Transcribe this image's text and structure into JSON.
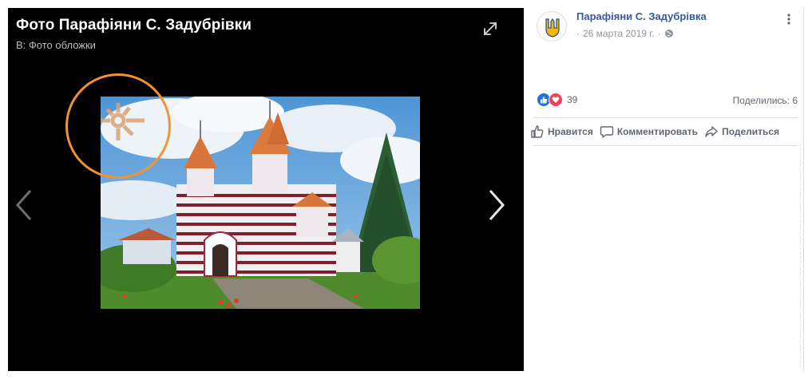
{
  "viewer": {
    "title": "Фото Парафіяни С. Задубрівки",
    "subtitle": "В: Фото обложки",
    "background": "#000000",
    "ring_color": "#f39232"
  },
  "post": {
    "page_name": "Парафіяни С. Задубрівка",
    "date": "26 марта 2019 г.",
    "dot": "·",
    "reaction_count": "39",
    "shares": "Поделились: 6",
    "link_color": "#385898"
  },
  "actions": {
    "like": "Нравится",
    "comment": "Комментировать",
    "share": "Поделиться"
  },
  "icons": {
    "expand": "expand-icon",
    "prev": "chevron-left-icon",
    "next": "chevron-right-icon",
    "globe": "globe-icon",
    "more": "more-vertical-icon",
    "like_reaction": "thumbs-up-icon",
    "love_reaction": "heart-icon"
  }
}
